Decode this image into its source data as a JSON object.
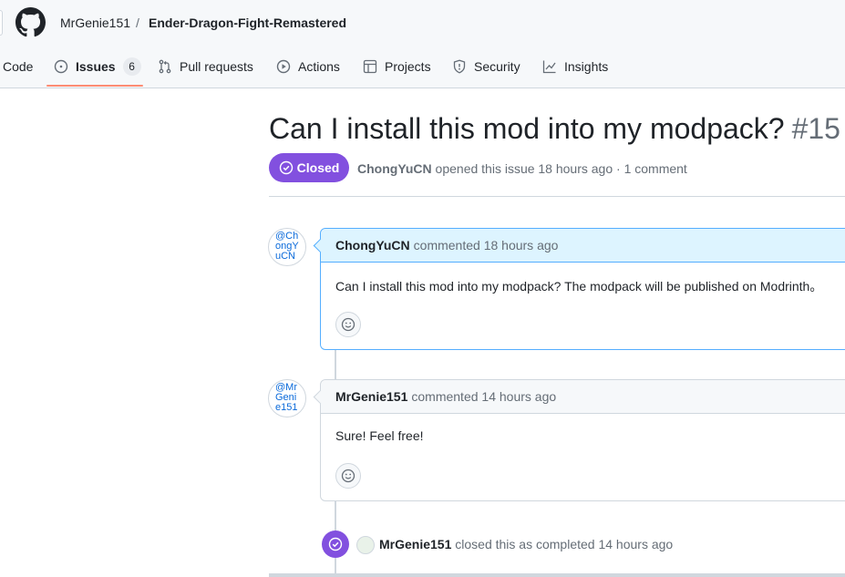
{
  "repo": {
    "owner": "MrGenie151",
    "separator": "/",
    "name": "Ender-Dragon-Fight-Remastered"
  },
  "tabs": [
    {
      "label": "Code",
      "icon": "code-icon"
    },
    {
      "label": "Issues",
      "icon": "issue-opened-icon",
      "count": "6",
      "selected": true
    },
    {
      "label": "Pull requests",
      "icon": "git-pull-request-icon"
    },
    {
      "label": "Actions",
      "icon": "play-icon"
    },
    {
      "label": "Projects",
      "icon": "table-icon"
    },
    {
      "label": "Security",
      "icon": "shield-icon"
    },
    {
      "label": "Insights",
      "icon": "graph-icon"
    }
  ],
  "issue": {
    "title": "Can I install this mod into my modpack?",
    "number": "#15",
    "state": "Closed",
    "author": "ChongYuCN",
    "meta_text": " opened this issue 18 hours ago · 1 comment"
  },
  "comments": [
    {
      "avatar_alt": "@ChongYuCN",
      "author": "ChongYuCN",
      "action": "commented 18 hours ago",
      "body": "Can I install this mod into my modpack? The modpack will be published on Modrinth。"
    },
    {
      "avatar_alt": "@MrGenie151",
      "author": "MrGenie151",
      "action": "commented 14 hours ago",
      "body": "Sure! Feel free!"
    }
  ],
  "event": {
    "actor": "MrGenie151",
    "text": " closed this as completed 14 hours ago"
  },
  "colors": {
    "accent_purple": "#8250df",
    "tab_underline": "#fd8c73",
    "author_comment_header": "#ddf4ff"
  }
}
